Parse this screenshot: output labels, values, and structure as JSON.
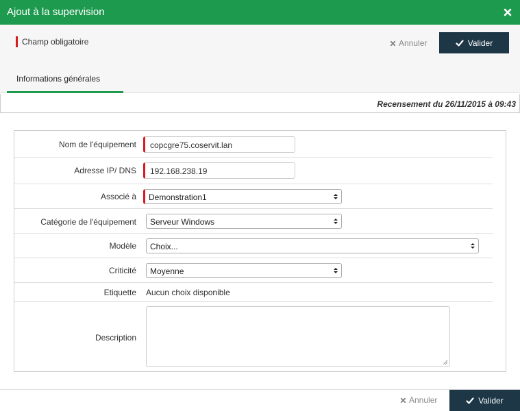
{
  "dialog": {
    "title": "Ajout à la supervision",
    "close_icon": "close-icon"
  },
  "toolbar": {
    "required_legend": "Champ obligatoire",
    "cancel_label": "Annuler",
    "submit_label": "Valider"
  },
  "tabs": [
    {
      "label": "Informations générales",
      "active": true
    }
  ],
  "census_text": "Recensement du 26/11/2015 à 09:43",
  "form": {
    "name": {
      "label": "Nom de l'équipement",
      "value": "copcgre75.coservit.lan",
      "required": true
    },
    "address": {
      "label": "Adresse IP/ DNS",
      "value": "192.168.238.19",
      "required": true
    },
    "associated": {
      "label": "Associé à",
      "value": "Demonstration1",
      "required": true
    },
    "category": {
      "label": "Catégorie de l'équipement",
      "value": "Serveur Windows"
    },
    "model": {
      "label": "Modèle",
      "value": "Choix..."
    },
    "criticality": {
      "label": "Criticité",
      "value": "Moyenne"
    },
    "tag": {
      "label": "Etiquette",
      "value": "Aucun choix disponible"
    },
    "description": {
      "label": "Description",
      "value": ""
    }
  },
  "footer": {
    "cancel_label": "Annuler",
    "submit_label": "Valider"
  },
  "colors": {
    "header_green": "#1e9a4f",
    "required_red": "#d9181f",
    "submit_dark": "#1d3746"
  }
}
